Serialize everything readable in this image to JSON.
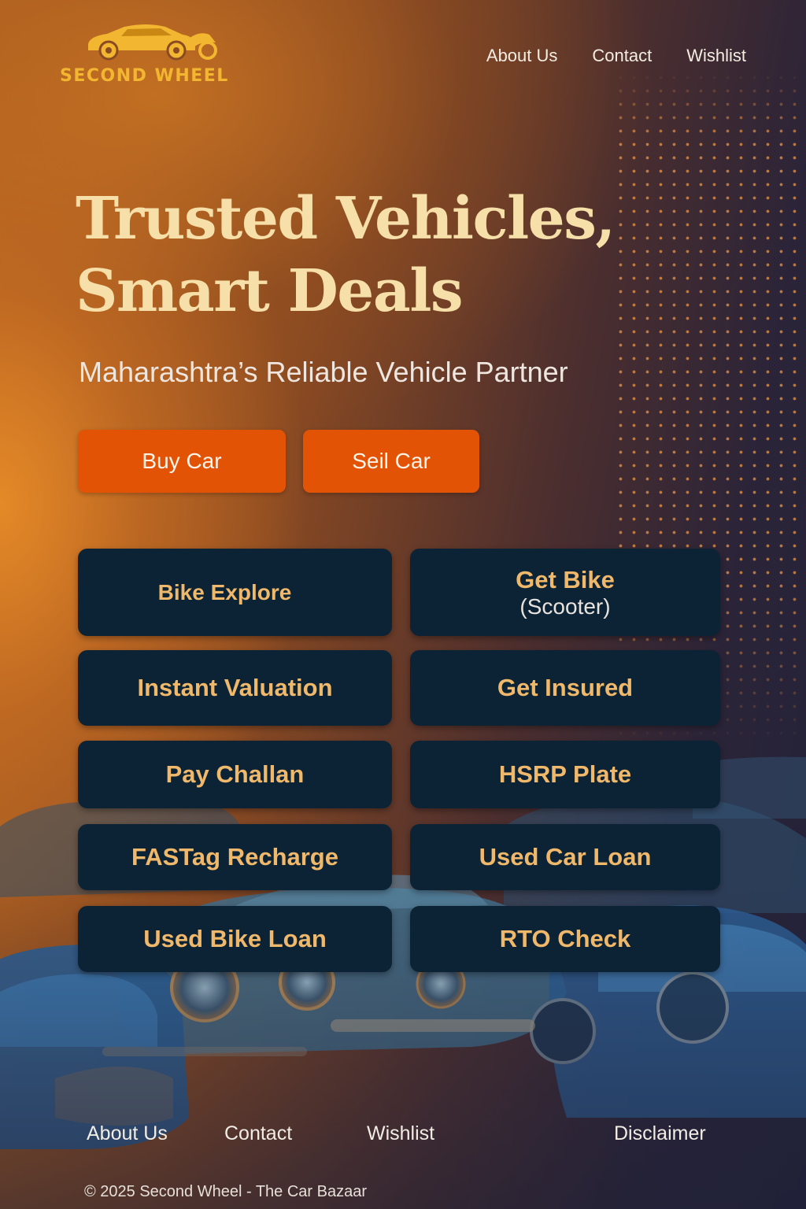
{
  "brand": {
    "name": "SECOND WHEEL",
    "logo_icon": "car-motorbike-logo-icon",
    "logo_color": "#f2b630"
  },
  "top_nav": {
    "items": [
      {
        "label": "About Us"
      },
      {
        "label": "Contact"
      },
      {
        "label": "Wishlist"
      }
    ]
  },
  "hero": {
    "title_line1": "Trusted Vehicles,",
    "title_line2": "Smart Deals",
    "subtitle": "Maharashtra’s Reliable Vehicle Partner"
  },
  "cta": {
    "buy_label": "Buy Car",
    "sell_label": "Seil Car",
    "color": "#e25306"
  },
  "services": {
    "tile_color": "#0c2336",
    "text_color": "#f0b86a",
    "items": [
      {
        "label": "Bike Explore",
        "sub": ""
      },
      {
        "label": "Get Bike",
        "sub": "(Scooter)"
      },
      {
        "label": "Instant Valuation",
        "sub": ""
      },
      {
        "label": "Get Insured",
        "sub": ""
      },
      {
        "label": "Pay Challan",
        "sub": ""
      },
      {
        "label": "HSRP Plate",
        "sub": ""
      },
      {
        "label": "FASTag Recharge",
        "sub": ""
      },
      {
        "label": "Used Car Loan",
        "sub": ""
      },
      {
        "label": "Used Bike Loan",
        "sub": ""
      },
      {
        "label": "RTO Check",
        "sub": ""
      }
    ]
  },
  "footer": {
    "nav": [
      {
        "label": "About Us"
      },
      {
        "label": "Contact"
      },
      {
        "label": "Wishlist"
      },
      {
        "label": "Disclaimer"
      }
    ],
    "copyright": "© 2025 Second Wheel - The Car Bazaar"
  }
}
